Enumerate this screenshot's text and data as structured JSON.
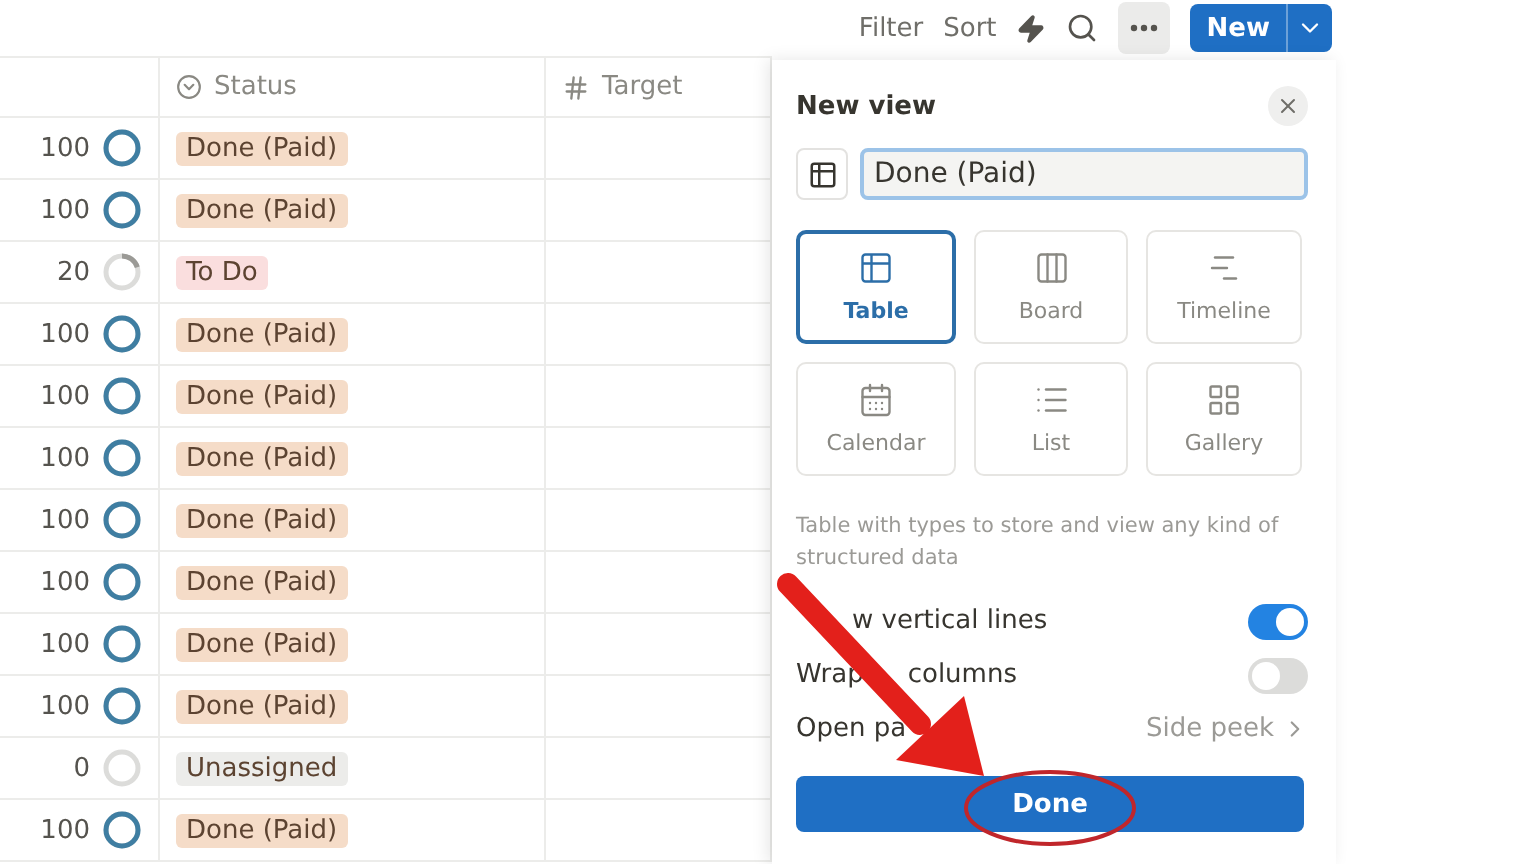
{
  "toolbar": {
    "filter": "Filter",
    "sort": "Sort",
    "new_button": "New"
  },
  "table": {
    "columns": [
      {
        "kind": "status",
        "label": "Status"
      },
      {
        "kind": "number",
        "label": "Target"
      }
    ],
    "rows": [
      {
        "number": "100",
        "kind": "full",
        "status": "Done (Paid)",
        "color": "#f5dcc8"
      },
      {
        "number": "100",
        "kind": "full",
        "status": "Done (Paid)",
        "color": "#f5dcc8"
      },
      {
        "number": "20",
        "kind": "partial",
        "status": "To Do",
        "color": "#fadede"
      },
      {
        "number": "100",
        "kind": "full",
        "status": "Done (Paid)",
        "color": "#f5dcc8"
      },
      {
        "number": "100",
        "kind": "full",
        "status": "Done (Paid)",
        "color": "#f5dcc8"
      },
      {
        "number": "100",
        "kind": "full",
        "status": "Done (Paid)",
        "color": "#f5dcc8"
      },
      {
        "number": "100",
        "kind": "full",
        "status": "Done (Paid)",
        "color": "#f5dcc8"
      },
      {
        "number": "100",
        "kind": "full",
        "status": "Done (Paid)",
        "color": "#f5dcc8"
      },
      {
        "number": "100",
        "kind": "full",
        "status": "Done (Paid)",
        "color": "#f5dcc8"
      },
      {
        "number": "100",
        "kind": "full",
        "status": "Done (Paid)",
        "color": "#f5dcc8"
      },
      {
        "number": "0",
        "kind": "empty",
        "status": "Unassigned",
        "color": "#ececea"
      },
      {
        "number": "100",
        "kind": "full",
        "status": "Done (Paid)",
        "color": "#f5dcc8"
      }
    ]
  },
  "panel": {
    "title": "New view",
    "name_value": "Done (Paid)",
    "views": [
      {
        "kind": "table",
        "label": "Table",
        "selected": true
      },
      {
        "kind": "board",
        "label": "Board",
        "selected": false
      },
      {
        "kind": "timeline",
        "label": "Timeline",
        "selected": false
      },
      {
        "kind": "calendar",
        "label": "Calendar",
        "selected": false
      },
      {
        "kind": "list",
        "label": "List",
        "selected": false
      },
      {
        "kind": "gallery",
        "label": "Gallery",
        "selected": false
      }
    ],
    "description": "Table with types to store and view any kind of structured data",
    "settings": [
      {
        "kind": "toggle",
        "parts": [
          "w vertical lines"
        ],
        "on": true
      },
      {
        "kind": "toggle",
        "parts": [
          "Wrap",
          "columns"
        ],
        "on": false
      },
      {
        "kind": "link",
        "parts": [
          "Open pa"
        ],
        "value": "Side peek"
      }
    ],
    "done_button": "Done"
  }
}
